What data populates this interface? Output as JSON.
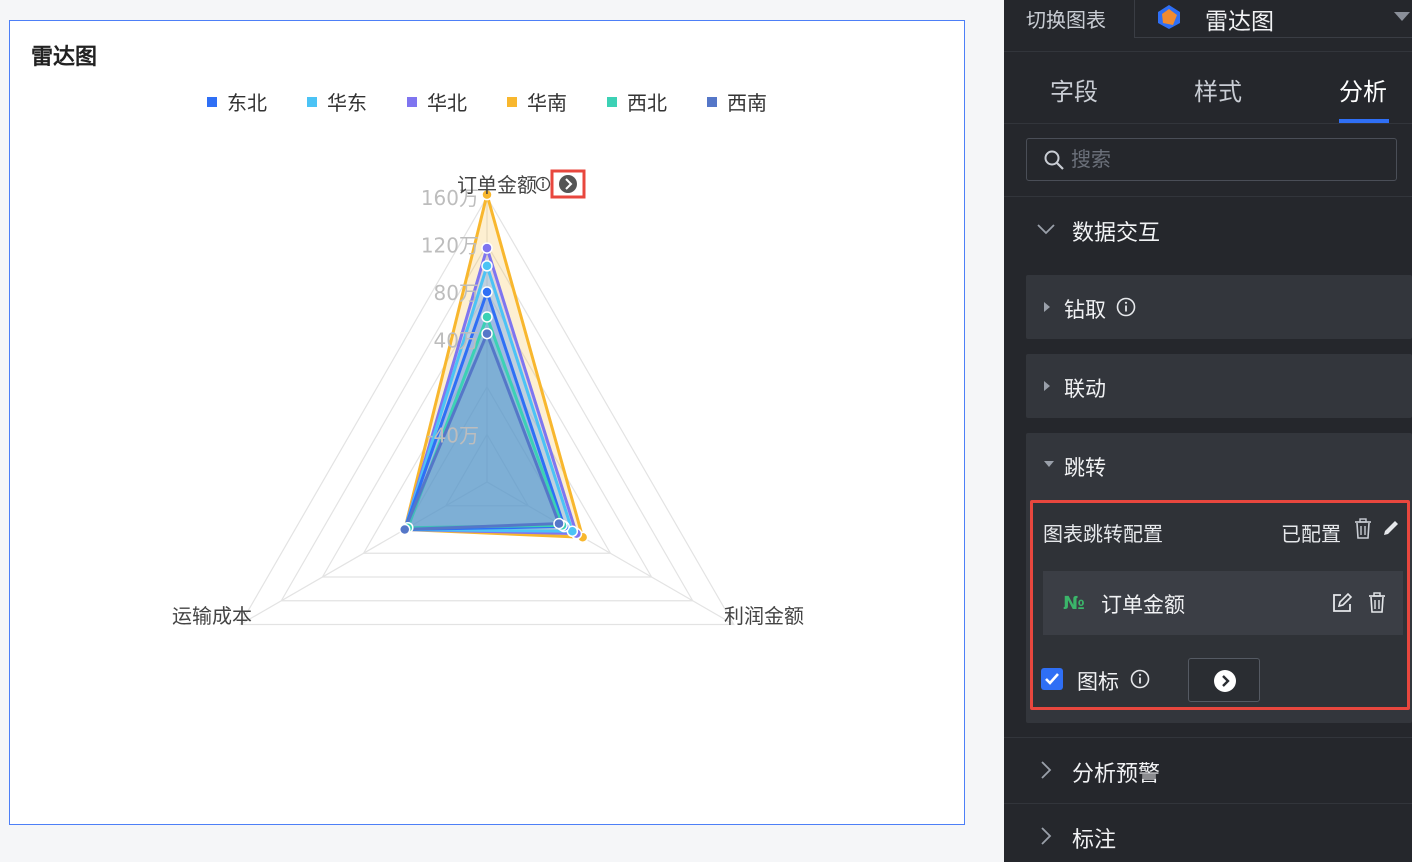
{
  "chart": {
    "title": "雷达图",
    "axis_icon_colors": {
      "box": "#e8473e",
      "circle": "#555555"
    }
  },
  "chart_data": {
    "type": "radar",
    "indicators": [
      "订单金额",
      "利润金额",
      "运输成本"
    ],
    "radial_ticks": [
      "-40万",
      "40万",
      "80万",
      "120万",
      "160万"
    ],
    "range": [
      -80,
      160
    ],
    "unit": "万",
    "series": [
      {
        "name": "东北",
        "color": "#2f6ff5",
        "values": [
          80,
          -5,
          0
        ]
      },
      {
        "name": "华东",
        "color": "#4cc3f5",
        "values": [
          102,
          3,
          0
        ]
      },
      {
        "name": "华北",
        "color": "#7f75f0",
        "values": [
          117,
          7,
          0
        ]
      },
      {
        "name": "华南",
        "color": "#f8b72e",
        "values": [
          162,
          13,
          0
        ]
      },
      {
        "name": "西北",
        "color": "#3cd1b5",
        "values": [
          59,
          -7,
          -3
        ]
      },
      {
        "name": "西南",
        "color": "#5577c8",
        "values": [
          45,
          -10,
          0
        ]
      }
    ]
  },
  "panel": {
    "switch_label": "切换图表",
    "chart_type": "雷达图",
    "tabs": [
      {
        "label": "字段"
      },
      {
        "label": "样式"
      },
      {
        "label": "分析"
      }
    ],
    "search_placeholder": "搜索",
    "sections": {
      "data_interaction": "数据交互",
      "drill": "钻取",
      "linkage": "联动",
      "jump": "跳转",
      "alert": "分析预警",
      "annotation": "标注"
    },
    "jump_config": {
      "title": "图表跳转配置",
      "status": "已配置",
      "field_type": "№",
      "field_name": "订单金额",
      "icon_label": "图标"
    }
  }
}
